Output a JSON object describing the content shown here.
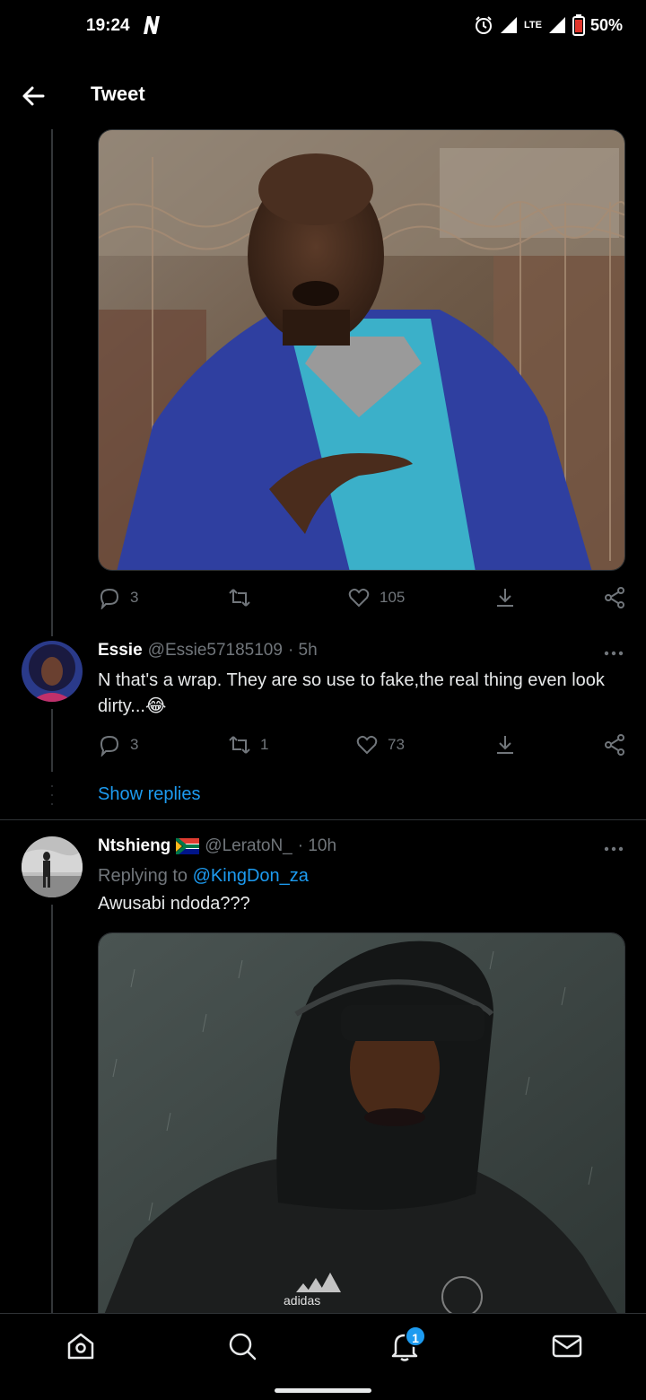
{
  "status_bar": {
    "time": "19:24",
    "network": "LTE",
    "battery": "50%"
  },
  "header": {
    "title": "Tweet"
  },
  "top_tweet": {
    "reply_count": "3",
    "retweet_count": "",
    "like_count": "105"
  },
  "reply1": {
    "name": "Essie",
    "handle": "@Essie57185109",
    "time": "· 5h",
    "text": "N that's a wrap. They are so use to fake,the real thing even look dirty...😂",
    "reply_count": "3",
    "retweet_count": "1",
    "like_count": "73",
    "show_replies": "Show replies"
  },
  "reply2": {
    "name": "Ntshieng",
    "handle": "@LeratoN_",
    "time": "· 10h",
    "replying_prefix": "Replying to",
    "replying_to": "@KingDon_za",
    "text": "Awusabi ndoda???"
  },
  "bottom_nav": {
    "notifications_badge": "1"
  },
  "colors": {
    "accent": "#1d9bf0",
    "background": "#000000",
    "muted": "#71767b"
  }
}
